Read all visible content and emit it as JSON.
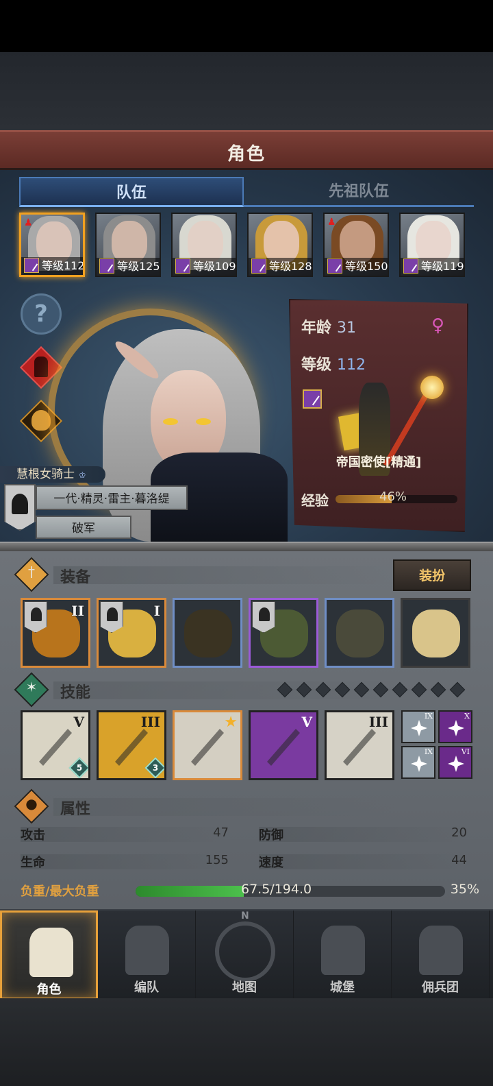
{
  "header": {
    "title": "角色"
  },
  "tabs": {
    "team": "队伍",
    "ancestor_team": "先祖队伍"
  },
  "roster": [
    {
      "level_label": "等级112",
      "selected": true,
      "hair": "#a9a9a9",
      "face": "#d9c3b8",
      "badge": true
    },
    {
      "level_label": "等级125",
      "selected": false,
      "hair": "#8c8c8c",
      "face": "#cfb6a8",
      "badge": false
    },
    {
      "level_label": "等级109",
      "selected": false,
      "hair": "#d8d8d0",
      "face": "#e2d0c6",
      "badge": false
    },
    {
      "level_label": "等级128",
      "selected": false,
      "hair": "#c89a3a",
      "face": "#e4c2aa",
      "badge": false
    },
    {
      "level_label": "等级150",
      "selected": false,
      "hair": "#7a4a24",
      "face": "#c49a80",
      "badge": true
    },
    {
      "level_label": "等级119",
      "selected": false,
      "hair": "#e6e6e0",
      "face": "#e8d6ce",
      "badge": false
    }
  ],
  "hero": {
    "name": "慧根女骑士",
    "lineage": "一代·精灵·雷主·暮洛缇",
    "title": "破军"
  },
  "info": {
    "age_label": "年龄",
    "age": "31",
    "level_label": "等级",
    "level": "112",
    "class_name": "帝国密使[精通]",
    "exp_label": "经验",
    "exp_percent": "46%",
    "exp_fraction": 0.46
  },
  "equipment": {
    "title": "装备",
    "outfit_button": "装扮",
    "slots": [
      {
        "rank": "II",
        "rarity": "orange",
        "flag": true,
        "art": "#b8741c"
      },
      {
        "rank": "I",
        "rarity": "orange",
        "flag": true,
        "art": "#d9b040"
      },
      {
        "rank": "",
        "rarity": "blue",
        "flag": false,
        "art": "#3a3322"
      },
      {
        "rank": "",
        "rarity": "purple",
        "flag": true,
        "art": "#4c5a34"
      },
      {
        "rank": "",
        "rarity": "blue",
        "flag": false,
        "art": "#4a4a3a"
      },
      {
        "rank": "",
        "rarity": "gray",
        "flag": false,
        "art": "#d9c48a"
      }
    ]
  },
  "skills": {
    "title": "技能",
    "gems": 10,
    "items": [
      {
        "rank": "V",
        "bg": "#d9d4c4",
        "level": "5",
        "star": false,
        "border": "#222"
      },
      {
        "rank": "III",
        "bg": "#d9a22a",
        "level": "3",
        "star": false,
        "border": "#222"
      },
      {
        "rank": "",
        "bg": "#d4cfc2",
        "level": "",
        "star": true,
        "border": "#d98a3a"
      },
      {
        "rank": "V",
        "bg": "#7a3aa0",
        "level": "",
        "star": false,
        "border": "#222"
      },
      {
        "rank": "III",
        "bg": "#d6d2c6",
        "level": "",
        "star": false,
        "border": "#222"
      }
    ],
    "mini": [
      {
        "rank": "IX",
        "bg": "#8e9aa4"
      },
      {
        "rank": "X",
        "bg": "#6a2a8a"
      },
      {
        "rank": "IX",
        "bg": "#8e9aa4"
      },
      {
        "rank": "VI",
        "bg": "#6a2a8a"
      }
    ]
  },
  "attributes": {
    "title": "属性",
    "attack_label": "攻击",
    "attack": "47",
    "defense_label": "防御",
    "defense": "20",
    "hp_label": "生命",
    "hp": "155",
    "speed_label": "速度",
    "speed": "44",
    "weight_label": "负重/最大负重",
    "weight": "67.5/194.0",
    "weight_percent": "35%",
    "weight_fraction": 0.35
  },
  "nav": [
    {
      "label": "角色",
      "active": true
    },
    {
      "label": "编队",
      "active": false
    },
    {
      "label": "地图",
      "active": false
    },
    {
      "label": "城堡",
      "active": false
    },
    {
      "label": "佣兵团",
      "active": false
    }
  ],
  "colors": {
    "title_bar": "#6b342d",
    "accent_gold": "#f0a020",
    "tab_blue": "#4b7ab6",
    "weight_green": "#4cc04c"
  }
}
